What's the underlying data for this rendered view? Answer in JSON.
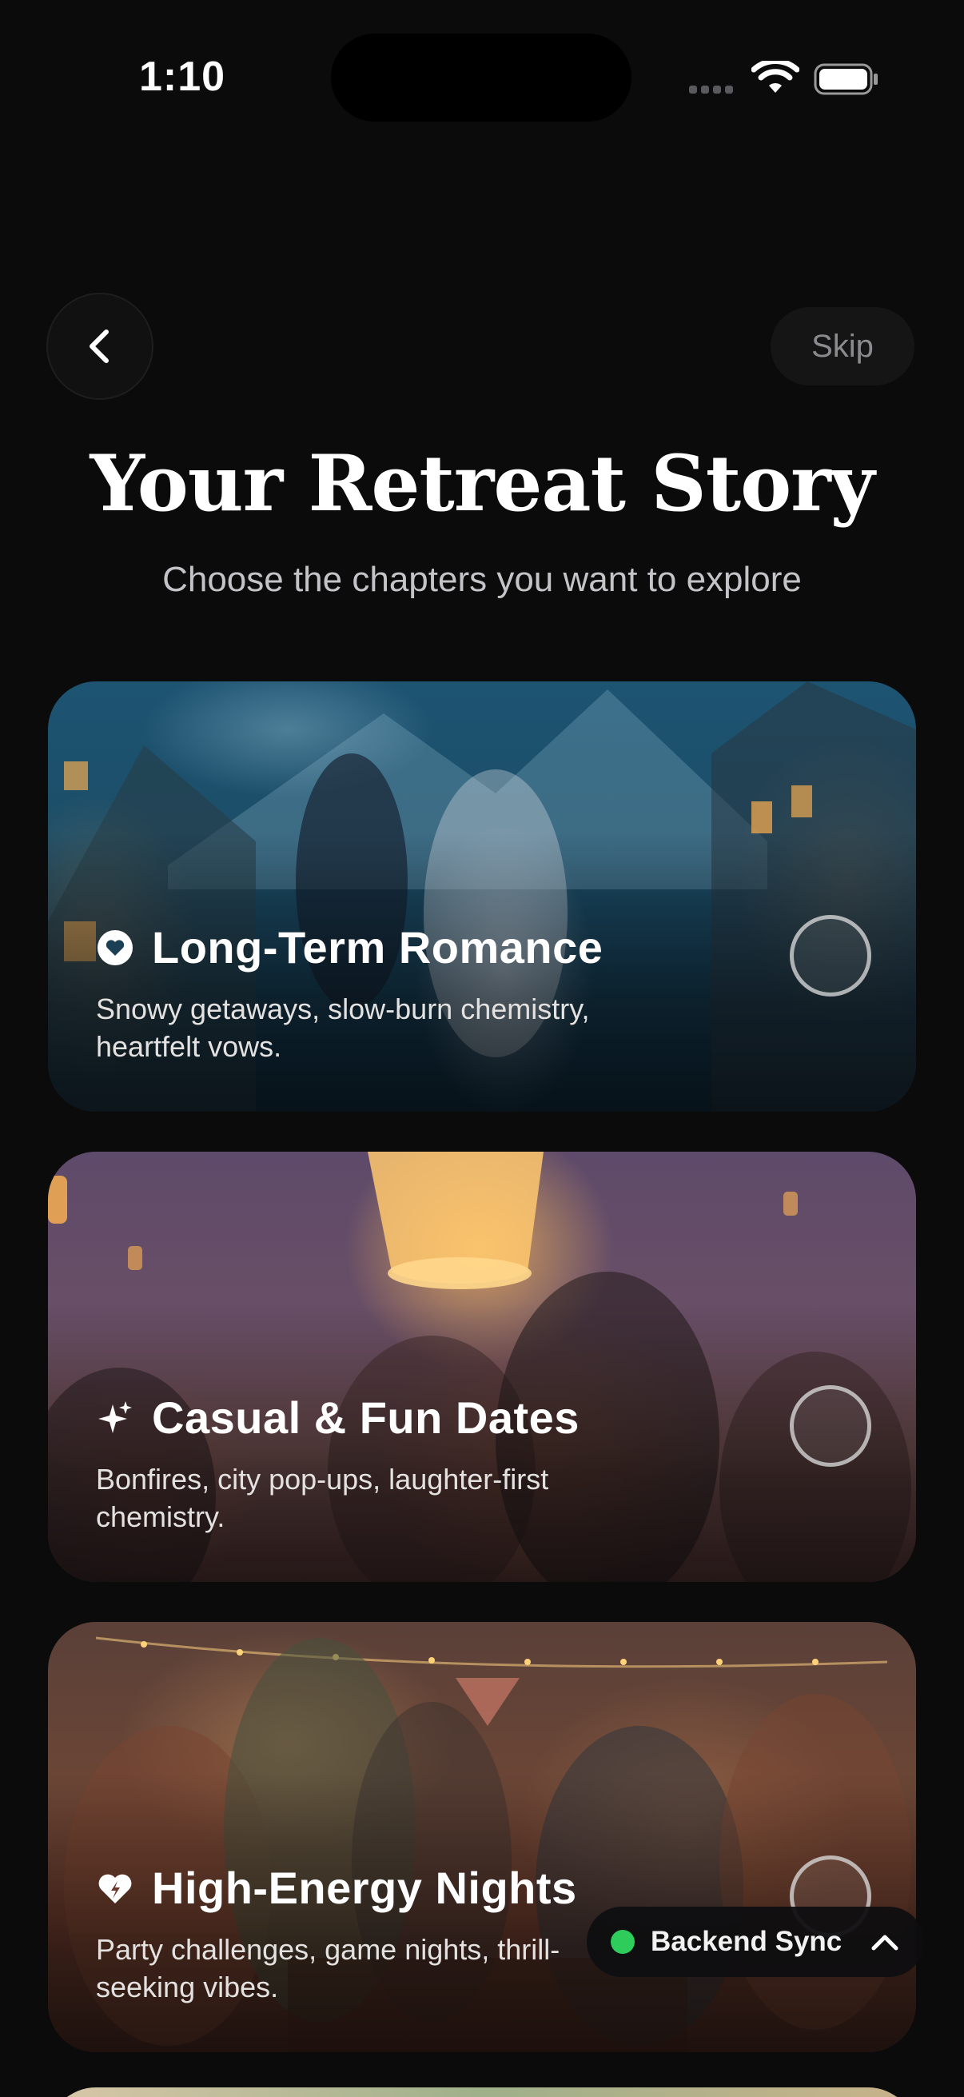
{
  "status_bar": {
    "time": "1:10"
  },
  "header": {
    "back_icon": "chevron-left-icon",
    "skip_label": "Skip"
  },
  "page": {
    "title": "Your Retreat Story",
    "subtitle": "Choose the chapters you want to explore"
  },
  "cards": [
    {
      "icon": "heart-badge-icon",
      "title": "Long-Term Romance",
      "description": "Snowy getaways, slow-burn chemistry, heartfelt vows.",
      "selected": false
    },
    {
      "icon": "sparkles-icon",
      "title": "Casual & Fun Dates",
      "description": "Bonfires, city pop-ups, laughter-first chemistry.",
      "selected": false
    },
    {
      "icon": "bolt-heart-icon",
      "title": "High-Energy Nights",
      "description": "Party challenges, game nights, thrill-seeking vibes.",
      "selected": false
    }
  ],
  "sync": {
    "label": "Backend Sync",
    "status_color": "#2ecc5a",
    "chevron": "chevron-up-icon"
  }
}
